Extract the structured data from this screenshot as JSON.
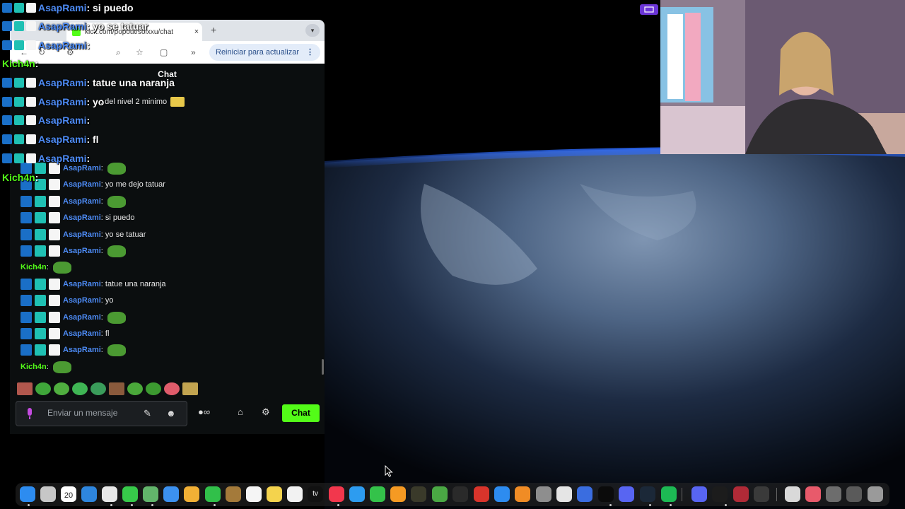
{
  "browser": {
    "tab_title": "kick.com/popout/solxxu/chat",
    "tab_close": "×",
    "new_tab": "+",
    "update_button": "Reiniciar para actualizar",
    "chat_header": "Chat"
  },
  "chat": {
    "messages": [
      {
        "user": "AsapRami",
        "text": ": ",
        "emote": "pepe"
      },
      {
        "user": "AsapRami",
        "text": ": yo me dejo tatuar",
        "emote": ""
      },
      {
        "user": "AsapRami",
        "text": ": ",
        "emote": "pepe"
      },
      {
        "user": "AsapRami",
        "text": ": si puedo",
        "emote": ""
      },
      {
        "user": "AsapRami",
        "text": ": yo se tatuar",
        "emote": ""
      },
      {
        "user": "AsapRami",
        "text": ": ",
        "emote": "pepe"
      },
      {
        "user": "Kich4n",
        "text": ": ",
        "emote": "pepe"
      },
      {
        "user": "AsapRami",
        "text": ": tatue una naranja",
        "emote": ""
      },
      {
        "user": "AsapRami",
        "text": ": yo",
        "emote": ""
      },
      {
        "user": "AsapRami",
        "text": ": ",
        "emote": "pepe"
      },
      {
        "user": "AsapRami",
        "text": ": fl",
        "emote": ""
      },
      {
        "user": "AsapRami",
        "text": ": ",
        "emote": "pepe"
      },
      {
        "user": "Kich4n",
        "text": ": ",
        "emote": "pepe"
      }
    ],
    "partial_message": ": del nivel 2 minimo",
    "input_placeholder": "Enviar un mensaje",
    "send_label": "Chat"
  },
  "overlay": {
    "messages": [
      {
        "user": "AsapRami",
        "text": ": si puedo"
      },
      {
        "user": "AsapRami",
        "text": ": yo se tatuar"
      },
      {
        "user": "AsapRami",
        "text": ":"
      },
      {
        "user": "Kich4n",
        "text": ":"
      },
      {
        "user": "AsapRami",
        "text": ": tatue una naranja"
      },
      {
        "user": "AsapRami",
        "text": ": yo"
      },
      {
        "user": "AsapRami",
        "text": ":"
      },
      {
        "user": "AsapRami",
        "text": ": fl"
      },
      {
        "user": "AsapRami",
        "text": ":"
      },
      {
        "user": "Kich4n",
        "text": ":"
      }
    ]
  },
  "dock": {
    "calendar_day": "20",
    "appletv_label": "tv"
  },
  "colors": {
    "kick_green": "#53fc18",
    "username_blue": "#4d8bf5",
    "stream_badge": "#6b35d6"
  }
}
